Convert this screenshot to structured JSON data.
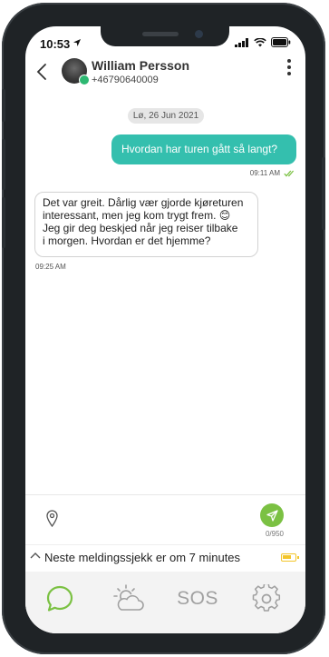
{
  "status": {
    "time": "10:53",
    "icons": [
      "location-arrow-icon",
      "signal-icon",
      "wifi-icon",
      "battery-icon"
    ]
  },
  "contact": {
    "name": "William Persson",
    "phone": "+46790640009"
  },
  "conversation": {
    "date": "Lø, 26 Jun 2021",
    "outgoing": {
      "text": "Hvordan har turen gått så langt?",
      "time": "09:11 AM",
      "status": "read"
    },
    "incoming": {
      "lines": [
        "Det var greit. Dårlig vær gjorde kjøreturen",
        "interessant, men jeg kom trygt frem. 😊",
        "Jeg gir deg beskjed når jeg reiser tilbake",
        "i morgen. Hvordan er det hjemme?"
      ],
      "time": "09:25 AM"
    }
  },
  "composer": {
    "char_count": "0/950"
  },
  "check_bar": {
    "text": "Neste meldingssjekk er om 7 minutes",
    "battery_level": 0.7
  },
  "tabs": [
    {
      "name": "messages",
      "icon": "chat-bubble-icon",
      "active": true
    },
    {
      "name": "weather",
      "icon": "weather-icon",
      "active": false
    },
    {
      "name": "sos",
      "label": "SOS",
      "active": false
    },
    {
      "name": "settings",
      "icon": "gear-icon",
      "active": false
    }
  ],
  "colors": {
    "accent": "#34bfae",
    "send": "#7bc143",
    "active_tab": "#7bc143",
    "inactive_tab": "#a0a0a0",
    "read_check": "#7bc143",
    "battery": "#f3c52a"
  }
}
